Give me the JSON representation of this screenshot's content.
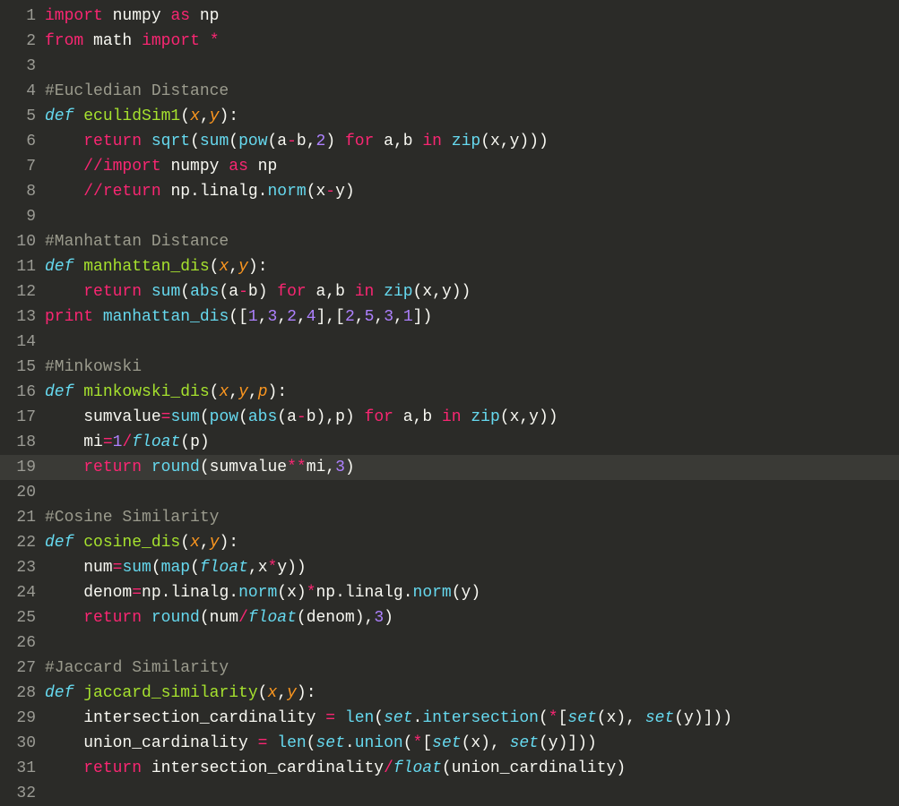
{
  "editor": {
    "highlighted_line": 19,
    "colors": {
      "background": "#2b2b28",
      "keyword": "#f92672",
      "function_def": "#a6e22e",
      "call": "#66d9ef",
      "argument": "#fd971f",
      "number": "#ae81ff",
      "operator": "#f92672",
      "comment": "#9b9b8d",
      "text": "#f8f8f2"
    },
    "lines": [
      {
        "n": 1,
        "tokens": [
          [
            "kw",
            "import"
          ],
          [
            "punc",
            " "
          ],
          [
            "mod",
            "numpy"
          ],
          [
            "punc",
            " "
          ],
          [
            "kw",
            "as"
          ],
          [
            "punc",
            " "
          ],
          [
            "mod",
            "np"
          ]
        ]
      },
      {
        "n": 2,
        "tokens": [
          [
            "kw",
            "from"
          ],
          [
            "punc",
            " "
          ],
          [
            "mod",
            "math"
          ],
          [
            "punc",
            " "
          ],
          [
            "kw",
            "import"
          ],
          [
            "punc",
            " "
          ],
          [
            "op",
            "*"
          ]
        ]
      },
      {
        "n": 3,
        "tokens": []
      },
      {
        "n": 4,
        "tokens": [
          [
            "comment",
            "#Eucledian Distance"
          ]
        ]
      },
      {
        "n": 5,
        "tokens": [
          [
            "calli",
            "def"
          ],
          [
            "punc",
            " "
          ],
          [
            "fn",
            "eculidSim1"
          ],
          [
            "punc",
            "("
          ],
          [
            "arg",
            "x"
          ],
          [
            "punc",
            ","
          ],
          [
            "arg",
            "y"
          ],
          [
            "punc",
            "):"
          ]
        ]
      },
      {
        "n": 6,
        "tokens": [
          [
            "punc",
            "    "
          ],
          [
            "kw",
            "return"
          ],
          [
            "punc",
            " "
          ],
          [
            "call",
            "sqrt"
          ],
          [
            "punc",
            "("
          ],
          [
            "call",
            "sum"
          ],
          [
            "punc",
            "("
          ],
          [
            "call",
            "pow"
          ],
          [
            "punc",
            "(a"
          ],
          [
            "op",
            "-"
          ],
          [
            "punc",
            "b,"
          ],
          [
            "num",
            "2"
          ],
          [
            "punc",
            ") "
          ],
          [
            "kw",
            "for"
          ],
          [
            "punc",
            " a,b "
          ],
          [
            "kw",
            "in"
          ],
          [
            "punc",
            " "
          ],
          [
            "call",
            "zip"
          ],
          [
            "punc",
            "(x,y)))"
          ]
        ]
      },
      {
        "n": 7,
        "tokens": [
          [
            "punc",
            "    "
          ],
          [
            "op",
            "//"
          ],
          [
            "kw",
            "import"
          ],
          [
            "punc",
            " numpy "
          ],
          [
            "kw",
            "as"
          ],
          [
            "punc",
            " np"
          ]
        ]
      },
      {
        "n": 8,
        "tokens": [
          [
            "punc",
            "    "
          ],
          [
            "op",
            "//"
          ],
          [
            "kw",
            "return"
          ],
          [
            "punc",
            " np.linalg."
          ],
          [
            "call",
            "norm"
          ],
          [
            "punc",
            "(x"
          ],
          [
            "op",
            "-"
          ],
          [
            "punc",
            "y)"
          ]
        ]
      },
      {
        "n": 9,
        "tokens": []
      },
      {
        "n": 10,
        "tokens": [
          [
            "comment",
            "#Manhattan Distance"
          ]
        ]
      },
      {
        "n": 11,
        "tokens": [
          [
            "calli",
            "def"
          ],
          [
            "punc",
            " "
          ],
          [
            "fn",
            "manhattan_dis"
          ],
          [
            "punc",
            "("
          ],
          [
            "arg",
            "x"
          ],
          [
            "punc",
            ","
          ],
          [
            "arg",
            "y"
          ],
          [
            "punc",
            "):"
          ]
        ]
      },
      {
        "n": 12,
        "tokens": [
          [
            "punc",
            "    "
          ],
          [
            "kw",
            "return"
          ],
          [
            "punc",
            " "
          ],
          [
            "call",
            "sum"
          ],
          [
            "punc",
            "("
          ],
          [
            "call",
            "abs"
          ],
          [
            "punc",
            "(a"
          ],
          [
            "op",
            "-"
          ],
          [
            "punc",
            "b) "
          ],
          [
            "kw",
            "for"
          ],
          [
            "punc",
            " a,b "
          ],
          [
            "kw",
            "in"
          ],
          [
            "punc",
            " "
          ],
          [
            "call",
            "zip"
          ],
          [
            "punc",
            "(x,y))"
          ]
        ]
      },
      {
        "n": 13,
        "tokens": [
          [
            "kw",
            "print"
          ],
          [
            "punc",
            " "
          ],
          [
            "call",
            "manhattan_dis"
          ],
          [
            "punc",
            "(["
          ],
          [
            "num",
            "1"
          ],
          [
            "punc",
            ","
          ],
          [
            "num",
            "3"
          ],
          [
            "punc",
            ","
          ],
          [
            "num",
            "2"
          ],
          [
            "punc",
            ","
          ],
          [
            "num",
            "4"
          ],
          [
            "punc",
            "],["
          ],
          [
            "num",
            "2"
          ],
          [
            "punc",
            ","
          ],
          [
            "num",
            "5"
          ],
          [
            "punc",
            ","
          ],
          [
            "num",
            "3"
          ],
          [
            "punc",
            ","
          ],
          [
            "num",
            "1"
          ],
          [
            "punc",
            "])"
          ]
        ]
      },
      {
        "n": 14,
        "tokens": []
      },
      {
        "n": 15,
        "tokens": [
          [
            "comment",
            "#Minkowski"
          ]
        ]
      },
      {
        "n": 16,
        "tokens": [
          [
            "calli",
            "def"
          ],
          [
            "punc",
            " "
          ],
          [
            "fn",
            "minkowski_dis"
          ],
          [
            "punc",
            "("
          ],
          [
            "arg",
            "x"
          ],
          [
            "punc",
            ","
          ],
          [
            "arg",
            "y"
          ],
          [
            "punc",
            ","
          ],
          [
            "arg",
            "p"
          ],
          [
            "punc",
            "):"
          ]
        ]
      },
      {
        "n": 17,
        "tokens": [
          [
            "punc",
            "    sumvalue"
          ],
          [
            "op",
            "="
          ],
          [
            "call",
            "sum"
          ],
          [
            "punc",
            "("
          ],
          [
            "call",
            "pow"
          ],
          [
            "punc",
            "("
          ],
          [
            "call",
            "abs"
          ],
          [
            "punc",
            "(a"
          ],
          [
            "op",
            "-"
          ],
          [
            "punc",
            "b),p) "
          ],
          [
            "kw",
            "for"
          ],
          [
            "punc",
            " a,b "
          ],
          [
            "kw",
            "in"
          ],
          [
            "punc",
            " "
          ],
          [
            "call",
            "zip"
          ],
          [
            "punc",
            "(x,y))"
          ]
        ]
      },
      {
        "n": 18,
        "tokens": [
          [
            "punc",
            "    mi"
          ],
          [
            "op",
            "="
          ],
          [
            "num",
            "1"
          ],
          [
            "op",
            "/"
          ],
          [
            "calli",
            "float"
          ],
          [
            "punc",
            "(p)"
          ]
        ]
      },
      {
        "n": 19,
        "tokens": [
          [
            "punc",
            "    "
          ],
          [
            "kw",
            "return"
          ],
          [
            "punc",
            " "
          ],
          [
            "call",
            "round"
          ],
          [
            "punc",
            "(sumvalue"
          ],
          [
            "op",
            "**"
          ],
          [
            "punc",
            "mi,"
          ],
          [
            "num",
            "3"
          ],
          [
            "punc",
            ")"
          ]
        ]
      },
      {
        "n": 20,
        "tokens": []
      },
      {
        "n": 21,
        "tokens": [
          [
            "comment",
            "#Cosine Similarity"
          ]
        ]
      },
      {
        "n": 22,
        "tokens": [
          [
            "calli",
            "def"
          ],
          [
            "punc",
            " "
          ],
          [
            "fn",
            "cosine_dis"
          ],
          [
            "punc",
            "("
          ],
          [
            "arg",
            "x"
          ],
          [
            "punc",
            ","
          ],
          [
            "arg",
            "y"
          ],
          [
            "punc",
            "):"
          ]
        ]
      },
      {
        "n": 23,
        "tokens": [
          [
            "punc",
            "    num"
          ],
          [
            "op",
            "="
          ],
          [
            "call",
            "sum"
          ],
          [
            "punc",
            "("
          ],
          [
            "call",
            "map"
          ],
          [
            "punc",
            "("
          ],
          [
            "calli",
            "float"
          ],
          [
            "punc",
            ",x"
          ],
          [
            "op",
            "*"
          ],
          [
            "punc",
            "y))"
          ]
        ]
      },
      {
        "n": 24,
        "tokens": [
          [
            "punc",
            "    denom"
          ],
          [
            "op",
            "="
          ],
          [
            "punc",
            "np.linalg."
          ],
          [
            "call",
            "norm"
          ],
          [
            "punc",
            "(x)"
          ],
          [
            "op",
            "*"
          ],
          [
            "punc",
            "np.linalg."
          ],
          [
            "call",
            "norm"
          ],
          [
            "punc",
            "(y)"
          ]
        ]
      },
      {
        "n": 25,
        "tokens": [
          [
            "punc",
            "    "
          ],
          [
            "kw",
            "return"
          ],
          [
            "punc",
            " "
          ],
          [
            "call",
            "round"
          ],
          [
            "punc",
            "(num"
          ],
          [
            "op",
            "/"
          ],
          [
            "calli",
            "float"
          ],
          [
            "punc",
            "(denom),"
          ],
          [
            "num",
            "3"
          ],
          [
            "punc",
            ")"
          ]
        ]
      },
      {
        "n": 26,
        "tokens": []
      },
      {
        "n": 27,
        "tokens": [
          [
            "comment",
            "#Jaccard Similarity"
          ]
        ]
      },
      {
        "n": 28,
        "tokens": [
          [
            "calli",
            "def"
          ],
          [
            "punc",
            " "
          ],
          [
            "fn",
            "jaccard_similarity"
          ],
          [
            "punc",
            "("
          ],
          [
            "arg",
            "x"
          ],
          [
            "punc",
            ","
          ],
          [
            "arg",
            "y"
          ],
          [
            "punc",
            "):"
          ]
        ]
      },
      {
        "n": 29,
        "tokens": [
          [
            "punc",
            "    intersection_cardinality "
          ],
          [
            "op",
            "="
          ],
          [
            "punc",
            " "
          ],
          [
            "call",
            "len"
          ],
          [
            "punc",
            "("
          ],
          [
            "calli",
            "set"
          ],
          [
            "punc",
            "."
          ],
          [
            "call",
            "intersection"
          ],
          [
            "punc",
            "("
          ],
          [
            "op",
            "*"
          ],
          [
            "punc",
            "["
          ],
          [
            "calli",
            "set"
          ],
          [
            "punc",
            "(x), "
          ],
          [
            "calli",
            "set"
          ],
          [
            "punc",
            "(y)]))"
          ]
        ]
      },
      {
        "n": 30,
        "tokens": [
          [
            "punc",
            "    union_cardinality "
          ],
          [
            "op",
            "="
          ],
          [
            "punc",
            " "
          ],
          [
            "call",
            "len"
          ],
          [
            "punc",
            "("
          ],
          [
            "calli",
            "set"
          ],
          [
            "punc",
            "."
          ],
          [
            "call",
            "union"
          ],
          [
            "punc",
            "("
          ],
          [
            "op",
            "*"
          ],
          [
            "punc",
            "["
          ],
          [
            "calli",
            "set"
          ],
          [
            "punc",
            "(x), "
          ],
          [
            "calli",
            "set"
          ],
          [
            "punc",
            "(y)]))"
          ]
        ]
      },
      {
        "n": 31,
        "tokens": [
          [
            "punc",
            "    "
          ],
          [
            "kw",
            "return"
          ],
          [
            "punc",
            " intersection_cardinality"
          ],
          [
            "op",
            "/"
          ],
          [
            "calli",
            "float"
          ],
          [
            "punc",
            "(union_cardinality)"
          ]
        ]
      },
      {
        "n": 32,
        "tokens": []
      }
    ]
  }
}
